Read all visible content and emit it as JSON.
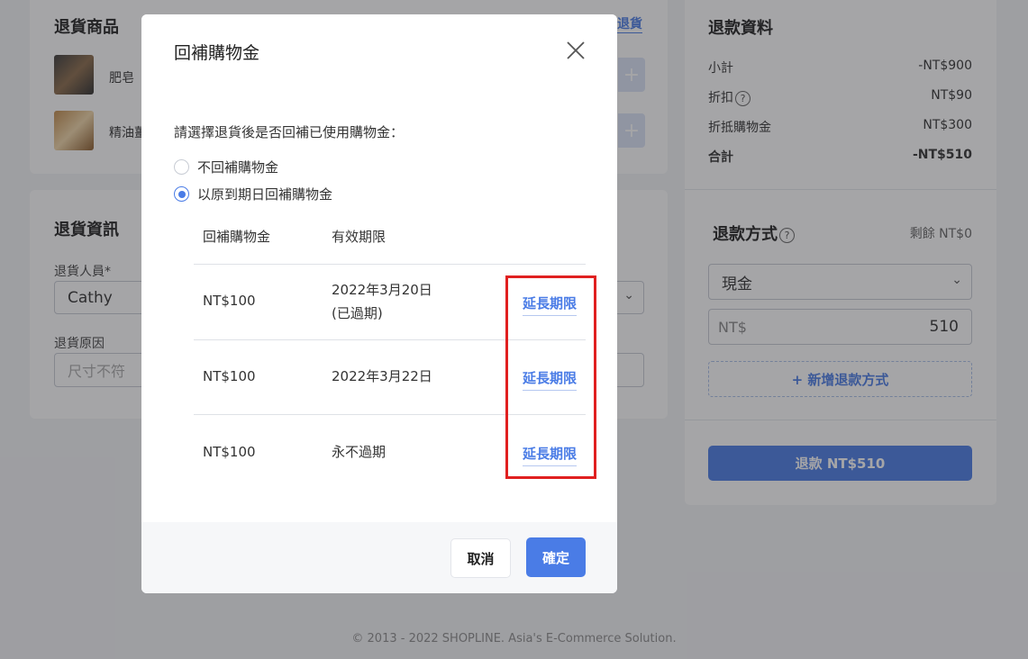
{
  "background": {
    "returned_items": {
      "title": "退貨商品",
      "link": "退貨",
      "items": [
        {
          "name": "肥皂"
        },
        {
          "name": "精油薑"
        }
      ]
    },
    "return_info": {
      "title": "退貨資訊",
      "staff_label": "退貨人員*",
      "staff_value": "Cathy",
      "reason_label": "退貨原因",
      "reason_placeholder": "尺寸不符"
    },
    "refund_data": {
      "title": "退款資料",
      "rows": [
        {
          "label": "小計",
          "value": "-NT$900"
        },
        {
          "label": "折扣",
          "value": "NT$90"
        },
        {
          "label": "折抵購物金",
          "value": "NT$300"
        },
        {
          "label": "合計",
          "value": "-NT$510"
        }
      ]
    },
    "refund_method": {
      "title": "退款方式",
      "remaining": "剩餘 NT$0",
      "method_value": "現金",
      "amount_prefix": "NT$",
      "amount_value": "510",
      "add_method_label": "+ 新增退款方式",
      "refund_button": "退款 NT$510"
    },
    "footer": "© 2013 - 2022 SHOPLINE. Asia's E-Commerce Solution."
  },
  "modal": {
    "title": "回補購物金",
    "prompt": "請選擇退貨後是否回補已使用購物金：",
    "options": [
      {
        "label": "不回補購物金",
        "selected": false
      },
      {
        "label": "以原到期日回補購物金",
        "selected": true
      }
    ],
    "table": {
      "headers": [
        "回補購物金",
        "有效期限"
      ],
      "rows": [
        {
          "amount": "NT$100",
          "expiry": "2022年3月20日",
          "note": "(已過期)",
          "action": "延長期限"
        },
        {
          "amount": "NT$100",
          "expiry": "2022年3月22日",
          "note": "",
          "action": "延長期限"
        },
        {
          "amount": "NT$100",
          "expiry": "永不過期",
          "note": "",
          "action": "延長期限"
        }
      ]
    },
    "cancel_label": "取消",
    "confirm_label": "確定"
  },
  "colors": {
    "accent": "#4a7ce6",
    "highlight": "#e02020"
  }
}
